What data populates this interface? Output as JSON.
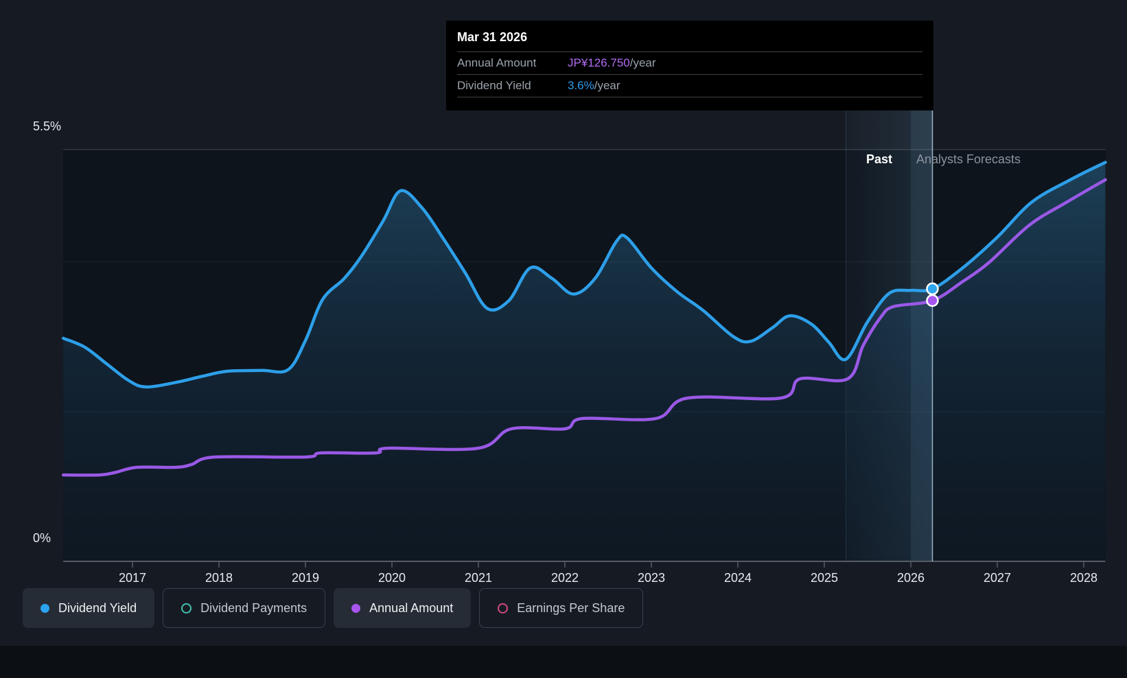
{
  "tooltip": {
    "title": "Mar 31 2026",
    "rows": [
      {
        "label": "Annual Amount",
        "value": "JP¥126.750",
        "suffix": "/year",
        "color": "#b36bf5"
      },
      {
        "label": "Dividend Yield",
        "value": "3.6%",
        "suffix": "/year",
        "color": "#2d9cec"
      }
    ]
  },
  "annotations": {
    "past_label": "Past",
    "forecast_label": "Analysts Forecasts"
  },
  "legend": [
    {
      "label": "Dividend Yield",
      "color": "#2aa3f0",
      "active": true
    },
    {
      "label": "Dividend Payments",
      "color": "#43c2ae",
      "active": false
    },
    {
      "label": "Annual Amount",
      "color": "#a855f0",
      "active": true
    },
    {
      "label": "Earnings Per Share",
      "color": "#d2487c",
      "active": false
    }
  ],
  "colors": {
    "line_blue": "#2d9fe9",
    "line_purple": "#9a59e6",
    "marker_blue": "#2fa6f0",
    "marker_purple": "#a855f0",
    "crosshair": "#a9c3d6",
    "axis": "#565c64",
    "grid_strong": "rgba(170,180,192,0.32)",
    "grid_faint": "rgba(170,185,200,0.10)",
    "area_top": "rgba(52,132,180,0.42)",
    "area_mid": "rgba(32,85,125,0.25)",
    "area_bottom": "rgba(18,48,75,0.12)",
    "band": "rgba(125,190,235,0.13)",
    "band_bright": "rgba(140,200,240,0.10)"
  },
  "chart_data": {
    "type": "area",
    "title": "Dividend history and forecast",
    "x_axis": {
      "ticks": [
        2017,
        2018,
        2019,
        2020,
        2021,
        2022,
        2023,
        2024,
        2025,
        2026,
        2027,
        2028
      ],
      "range": [
        2016.2,
        2028.25
      ]
    },
    "y_axis": {
      "label_top": "5.5%",
      "label_bottom": "0%",
      "min": 0,
      "max": 5.5,
      "unit": "%",
      "gridlines_pct": [
        2,
        4
      ]
    },
    "series": [
      {
        "name": "Dividend Yield",
        "unit": "percent",
        "color": "#2d9fe9",
        "style": "smooth-area",
        "points": [
          [
            2016.2,
            2.98
          ],
          [
            2016.45,
            2.86
          ],
          [
            2016.7,
            2.64
          ],
          [
            2016.95,
            2.42
          ],
          [
            2017.15,
            2.33
          ],
          [
            2017.5,
            2.39
          ],
          [
            2017.8,
            2.47
          ],
          [
            2018.1,
            2.54
          ],
          [
            2018.5,
            2.55
          ],
          [
            2018.8,
            2.56
          ],
          [
            2019.0,
            2.95
          ],
          [
            2019.2,
            3.5
          ],
          [
            2019.45,
            3.78
          ],
          [
            2019.65,
            4.08
          ],
          [
            2019.9,
            4.55
          ],
          [
            2020.1,
            4.95
          ],
          [
            2020.35,
            4.72
          ],
          [
            2020.6,
            4.3
          ],
          [
            2020.85,
            3.85
          ],
          [
            2021.1,
            3.38
          ],
          [
            2021.35,
            3.48
          ],
          [
            2021.6,
            3.92
          ],
          [
            2021.85,
            3.78
          ],
          [
            2022.1,
            3.57
          ],
          [
            2022.35,
            3.78
          ],
          [
            2022.6,
            4.28
          ],
          [
            2022.72,
            4.32
          ],
          [
            2023.0,
            3.92
          ],
          [
            2023.3,
            3.6
          ],
          [
            2023.6,
            3.35
          ],
          [
            2023.95,
            3.0
          ],
          [
            2024.15,
            2.94
          ],
          [
            2024.4,
            3.12
          ],
          [
            2024.6,
            3.28
          ],
          [
            2024.85,
            3.17
          ],
          [
            2025.05,
            2.93
          ],
          [
            2025.25,
            2.7
          ],
          [
            2025.5,
            3.2
          ],
          [
            2025.75,
            3.58
          ],
          [
            2026.0,
            3.62
          ],
          [
            2026.25,
            3.64
          ],
          [
            2026.6,
            3.92
          ],
          [
            2027.0,
            4.33
          ],
          [
            2027.4,
            4.8
          ],
          [
            2027.85,
            5.1
          ],
          [
            2028.25,
            5.33
          ]
        ]
      },
      {
        "name": "Annual Amount",
        "unit": "JPY_per_year",
        "color": "#9a59e6",
        "style": "smooth-line",
        "points": [
          [
            2016.2,
            42.0
          ],
          [
            2016.62,
            42.0
          ],
          [
            2016.8,
            43.2
          ],
          [
            2017.05,
            45.7
          ],
          [
            2017.5,
            45.7
          ],
          [
            2017.68,
            47.0
          ],
          [
            2017.95,
            50.7
          ],
          [
            2019.0,
            50.7
          ],
          [
            2019.18,
            52.7
          ],
          [
            2019.82,
            52.7
          ],
          [
            2019.95,
            55.0
          ],
          [
            2021.0,
            55.0
          ],
          [
            2021.38,
            64.4
          ],
          [
            2022.0,
            64.4
          ],
          [
            2022.2,
            69.4
          ],
          [
            2023.05,
            69.4
          ],
          [
            2023.42,
            79.4
          ],
          [
            2024.5,
            79.4
          ],
          [
            2024.72,
            88.7
          ],
          [
            2025.27,
            88.7
          ],
          [
            2025.45,
            105.0
          ],
          [
            2025.65,
            118.5
          ],
          [
            2025.8,
            123.8
          ],
          [
            2026.25,
            126.75
          ],
          [
            2026.6,
            136.0
          ],
          [
            2026.9,
            145.1
          ],
          [
            2027.37,
            163.4
          ],
          [
            2027.8,
            174.5
          ],
          [
            2028.25,
            185.5
          ]
        ]
      }
    ],
    "marker": {
      "x": 2026.25,
      "dividend_yield_pct": 3.64,
      "annual_amount_yen": 126.75
    },
    "highlight": {
      "band_start": 2025.25,
      "bright_band_start": 2026.0,
      "hover_x": 2026.25
    },
    "legend_position": "bottom",
    "grid": true
  }
}
